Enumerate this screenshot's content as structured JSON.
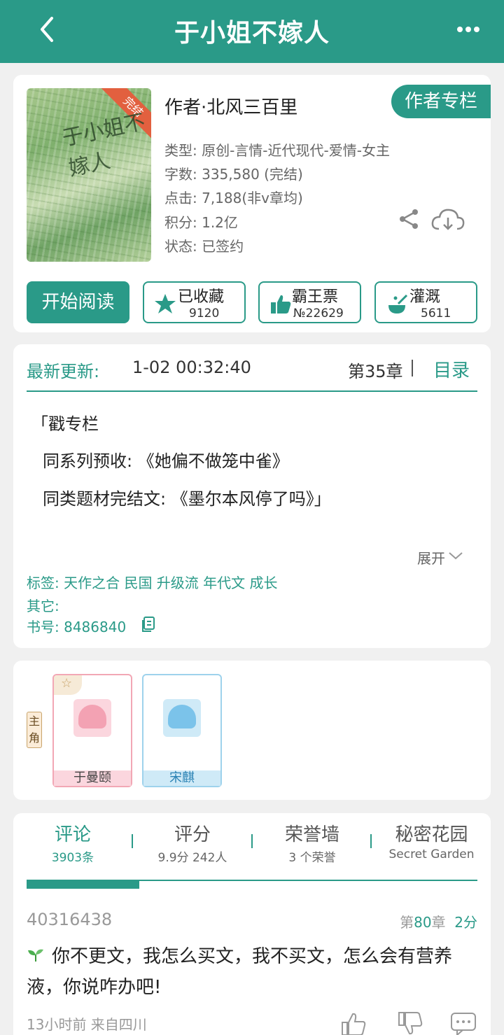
{
  "header": {
    "title": "于小姐不嫁人"
  },
  "book": {
    "cover_badge": "完结",
    "cover_title": "于小姐不嫁人",
    "author": "作者·北风三百里",
    "author_column": "作者专栏",
    "meta": [
      "类型: 原创-言情-近代现代-爱情-女主",
      "字数: 335,580 (完结)",
      "点击: 7,188(非v章均)",
      "积分: 1.2亿",
      "状态: 已签约"
    ]
  },
  "actions": {
    "read": "开始阅读",
    "collect": {
      "label": "已收藏",
      "count": "9120"
    },
    "vote": {
      "label": "霸王票",
      "count": "№22629"
    },
    "water": {
      "label": "灌溉",
      "count": "5611"
    }
  },
  "update": {
    "label": "最新更新:",
    "time": "1-02 00:32:40",
    "chapter": "第35章",
    "directory": "目录"
  },
  "intro": [
    "「戳专栏",
    "同系列预收: 《她偏不做笼中雀》",
    "同类题材完结文: 《墨尔本风停了吗》」"
  ],
  "expand": "展开",
  "tags": {
    "tags_line": "标签:  天作之合 民国 升级流 年代文 成长",
    "other_line": "其它:",
    "id_line": "书号:  8486840"
  },
  "roles": {
    "tag": "主角",
    "characters": [
      {
        "name": "于曼颐",
        "color": "#f2a7b5"
      },
      {
        "name": "宋麒",
        "color": "#9ed2ec"
      }
    ]
  },
  "tabs": [
    {
      "label": "评论",
      "sub": "3903条"
    },
    {
      "label": "评分",
      "sub": "9.9分 242人"
    },
    {
      "label": "荣誉墙",
      "sub": "3 个荣誉"
    },
    {
      "label": "秘密花园",
      "sub": "Secret Garden"
    }
  ],
  "comment": {
    "user": "40316438",
    "chapter_prefix": "第",
    "chapter_num": "80",
    "chapter_suffix": "章",
    "score": "2分",
    "text": "你不更文，我怎么买文，我不买文，怎么会有营养液，你说咋办吧!",
    "footer": "13小时前  来自四川"
  },
  "colors": {
    "accent": "#2a9a88",
    "badge": "#e2603f"
  },
  "icons": [
    "back-icon",
    "more-icon",
    "share-icon",
    "download-icon",
    "star-icon",
    "thumb-up-icon",
    "water-icon",
    "chevron-down-icon",
    "copy-icon",
    "sprout-icon",
    "like-icon",
    "dislike-icon",
    "reply-icon"
  ]
}
